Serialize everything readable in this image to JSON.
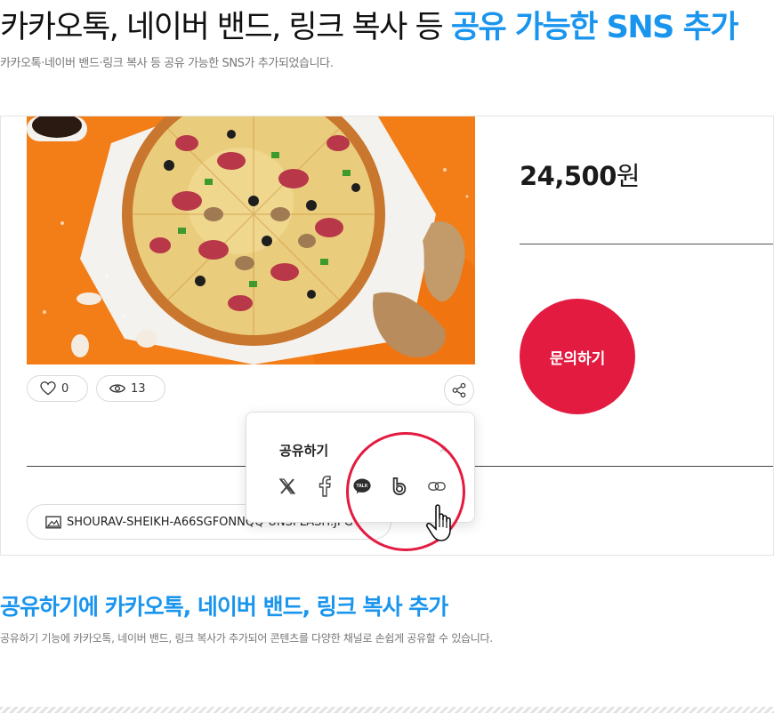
{
  "header": {
    "title_prefix": "카카오톡, 네이버 밴드, 링크 복사 등 ",
    "title_accent": "공유 가능한 SNS 추가",
    "subtitle": "카카오톡·네이버 밴드·링크 복사 등 공유 가능한 SNS가 추가되었습니다."
  },
  "product": {
    "image_icon": "pizza-photo",
    "likes": "0",
    "views": "13",
    "price_amount": "24,500",
    "price_unit": "원",
    "inquiry_label": "문의하기",
    "attachment_name": "SHOURAV-SHEIKH-A66SGFONNQQ-UNSPLASH.JPG"
  },
  "share_popup": {
    "title": "공유하기",
    "close_symbol": "×",
    "icons": [
      "x-logo-icon",
      "facebook-icon",
      "kakaotalk-icon",
      "naver-band-icon",
      "link-copy-icon"
    ],
    "kakao_text": "TALK"
  },
  "section": {
    "title": "공유하기에 카카오톡, 네이버 밴드, 링크 복사 추가",
    "description": "공유하기 기능에 카카오톡, 네이버 밴드, 링크 복사가 추가되어 콘텐츠를 다양한 채널로 손쉽게 공유할 수 있습니다."
  },
  "colors": {
    "accent_blue": "#1a95ee",
    "inquiry_red": "#e31b40",
    "photo_orange": "#f37d17"
  }
}
